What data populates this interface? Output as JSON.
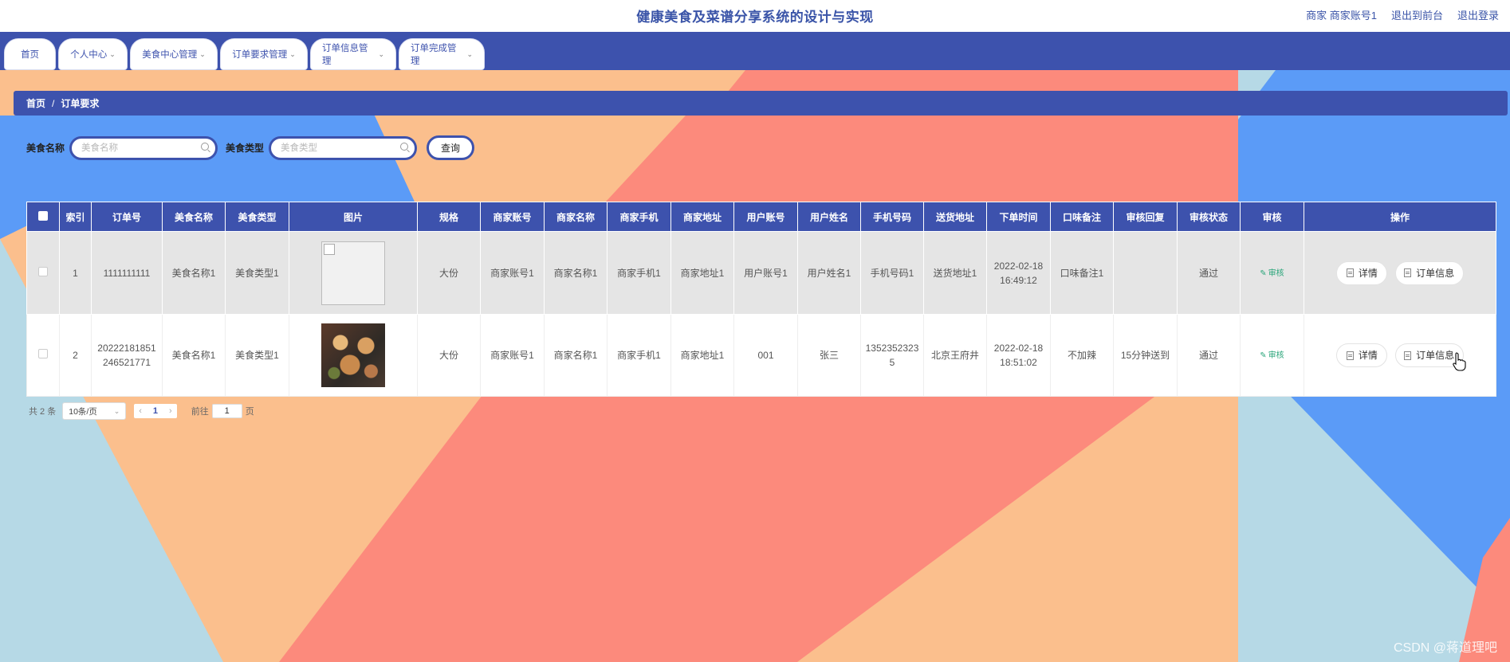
{
  "app": {
    "title": "健康美食及菜谱分享系统的设计与实现",
    "user_label": "商家 商家账号1",
    "to_frontend": "退出到前台",
    "logout": "退出登录"
  },
  "nav": {
    "tabs": [
      {
        "label": "首页",
        "has_arrow": false
      },
      {
        "label": "个人中心",
        "has_arrow": true
      },
      {
        "label": "美食中心管理",
        "has_arrow": true
      },
      {
        "label": "订单要求管理",
        "has_arrow": true
      },
      {
        "label": "订单信息管理",
        "has_arrow": true
      },
      {
        "label": "订单完成管理",
        "has_arrow": true
      }
    ]
  },
  "breadcrumb": {
    "home": "首页",
    "sep": "/",
    "current": "订单要求"
  },
  "search": {
    "food_name_label": "美食名称",
    "food_name_placeholder": "美食名称",
    "food_type_label": "美食类型",
    "food_type_placeholder": "美食类型",
    "query_label": "查询"
  },
  "table": {
    "headers": [
      "索引",
      "订单号",
      "美食名称",
      "美食类型",
      "图片",
      "规格",
      "商家账号",
      "商家名称",
      "商家手机",
      "商家地址",
      "用户账号",
      "用户姓名",
      "手机号码",
      "送货地址",
      "下单时间",
      "口味备注",
      "审核回复",
      "审核状态",
      "审核",
      "操作"
    ],
    "rows": [
      {
        "index": "1",
        "order_no": "1111111111",
        "food_name": "美食名称1",
        "food_type": "美食类型1",
        "image": "broken",
        "spec": "大份",
        "merchant_account": "商家账号1",
        "merchant_name": "商家名称1",
        "merchant_phone": "商家手机1",
        "merchant_address": "商家地址1",
        "user_account": "用户账号1",
        "user_name": "用户姓名1",
        "phone": "手机号码1",
        "delivery_address": "送货地址1",
        "order_time": "2022-02-18 16:49:12",
        "taste_note": "口味备注1",
        "audit_reply": "",
        "audit_status": "通过",
        "audit_action": "审核",
        "detail_btn": "详情",
        "order_btn": "订单信息"
      },
      {
        "index": "2",
        "order_no": "20222181851246521771",
        "food_name": "美食名称1",
        "food_type": "美食类型1",
        "image": "food-photo",
        "spec": "大份",
        "merchant_account": "商家账号1",
        "merchant_name": "商家名称1",
        "merchant_phone": "商家手机1",
        "merchant_address": "商家地址1",
        "user_account": "001",
        "user_name": "张三",
        "phone": "13523523235",
        "delivery_address": "北京王府井",
        "order_time": "2022-02-18 18:51:02",
        "taste_note": "不加辣",
        "audit_reply": "15分钟送到",
        "audit_status": "通过",
        "audit_action": "审核",
        "detail_btn": "详情",
        "order_btn": "订单信息"
      }
    ]
  },
  "pager": {
    "total": "共 2 条",
    "page_size": "10条/页",
    "current_page": "1",
    "goto_label": "前往",
    "goto_value": "1",
    "page_unit": "页"
  },
  "watermark": "CSDN @蒋道理吧",
  "colors": {
    "primary": "#3d52ad",
    "bg_blue": "#5b9bf7",
    "bg_peach": "#fbbf8d",
    "bg_coral": "#fc8a7c",
    "bg_light": "#b6d9e6"
  }
}
